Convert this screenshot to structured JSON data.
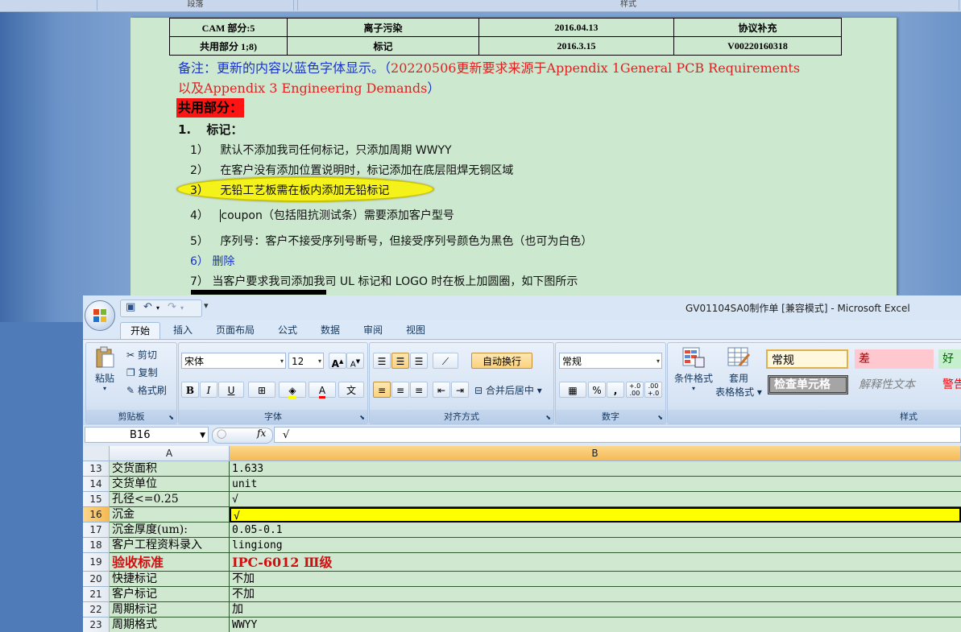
{
  "word": {
    "ribbon_groups": [
      "段落",
      "样式"
    ],
    "table": [
      [
        "CAM 部分:5",
        "离子污染",
        "2016.04.13",
        "协议补充"
      ],
      [
        "共用部分 1;8)",
        "标记",
        "2016.3.15",
        "V00220160318"
      ]
    ],
    "note_blue": "备注：更新的内容以蓝色字体显示。（",
    "note_red_1": "20220506更新要求来源于Appendix 1General PCB Requirements",
    "note_red_2": "以及Appendix 3 Engineering Demands",
    "note_blue_end": "）",
    "section_heading": "共用部分：",
    "item_heading_num": "1.",
    "item_heading": "标记：",
    "lines": [
      {
        "num": "1）",
        "text": "默认不添加我司任何标记，只添加周期 WWYY"
      },
      {
        "num": "2）",
        "text": "在客户没有添加位置说明时，标记添加在底层阻焊无铜区域"
      },
      {
        "num": "3）",
        "text": "无铅工艺板需在板内添加无铅标记"
      },
      {
        "num": "4）",
        "text": "coupon（包括阻抗测试条）需要添加客户型号"
      },
      {
        "num": "5）",
        "text": "序列号：客户不接受序列号断号，但接受序列号颜色为黑色（也可为白色）"
      },
      {
        "num": "6）",
        "text": "删除"
      },
      {
        "num": "7）",
        "text": "当客户要求我司添加我司 UL 标记和 LOGO 时在板上加圆圈，如下图所示"
      }
    ]
  },
  "excel": {
    "title": "GV01104SA0制作单  [兼容模式] - Microsoft Excel",
    "qat_more": "▾",
    "tabs": [
      "开始",
      "插入",
      "页面布局",
      "公式",
      "数据",
      "审阅",
      "视图"
    ],
    "clipboard": {
      "paste": "粘贴",
      "cut": "剪切",
      "copy": "复制",
      "format_painter": "格式刷",
      "label": "剪贴板"
    },
    "font": {
      "name": "宋体",
      "size": "12",
      "grow": "A",
      "shrink": "A",
      "bold": "B",
      "italic": "I",
      "underline": "U",
      "font_color": "A",
      "phonetic": "文",
      "label": "字体"
    },
    "alignment": {
      "wrap": "自动换行",
      "merge": "合并后居中",
      "label": "对齐方式"
    },
    "number": {
      "format": "常规",
      "percent": "%",
      "comma": ",",
      "inc": "+.0\n.00",
      "dec": ".00\n+.0",
      "label": "数字"
    },
    "styles": {
      "conditional": "条件格式",
      "table_1": "套用",
      "table_2": "表格格式",
      "normal": "常规",
      "bad": "差",
      "good": "好",
      "check_cell": "检查单元格",
      "explanatory": "解释性文本",
      "warning": "警告",
      "label": "样式"
    },
    "name_box": "B16",
    "fx": "fx",
    "formula": "√",
    "columns": [
      "A",
      "B"
    ],
    "rows": [
      {
        "num": "13",
        "a": "交货面积",
        "b": "1.633"
      },
      {
        "num": "14",
        "a": "交货单位",
        "b": "unit"
      },
      {
        "num": "15",
        "a": "孔径<=0.25",
        "b": "√"
      },
      {
        "num": "16",
        "a": "沉金",
        "b": "√"
      },
      {
        "num": "17",
        "a": "沉金厚度(um):",
        "b": "0.05-0.1"
      },
      {
        "num": "18",
        "a": "客户工程资料录入",
        "b": "lingiong"
      },
      {
        "num": "19",
        "a": "验收标准",
        "b": "IPC-6012 Ⅲ级"
      },
      {
        "num": "20",
        "a": "快捷标记",
        "b": "不加"
      },
      {
        "num": "21",
        "a": "客户标记",
        "b": "不加"
      },
      {
        "num": "22",
        "a": "周期标记",
        "b": "加"
      },
      {
        "num": "23",
        "a": "周期格式",
        "b": "WWYY"
      }
    ]
  }
}
